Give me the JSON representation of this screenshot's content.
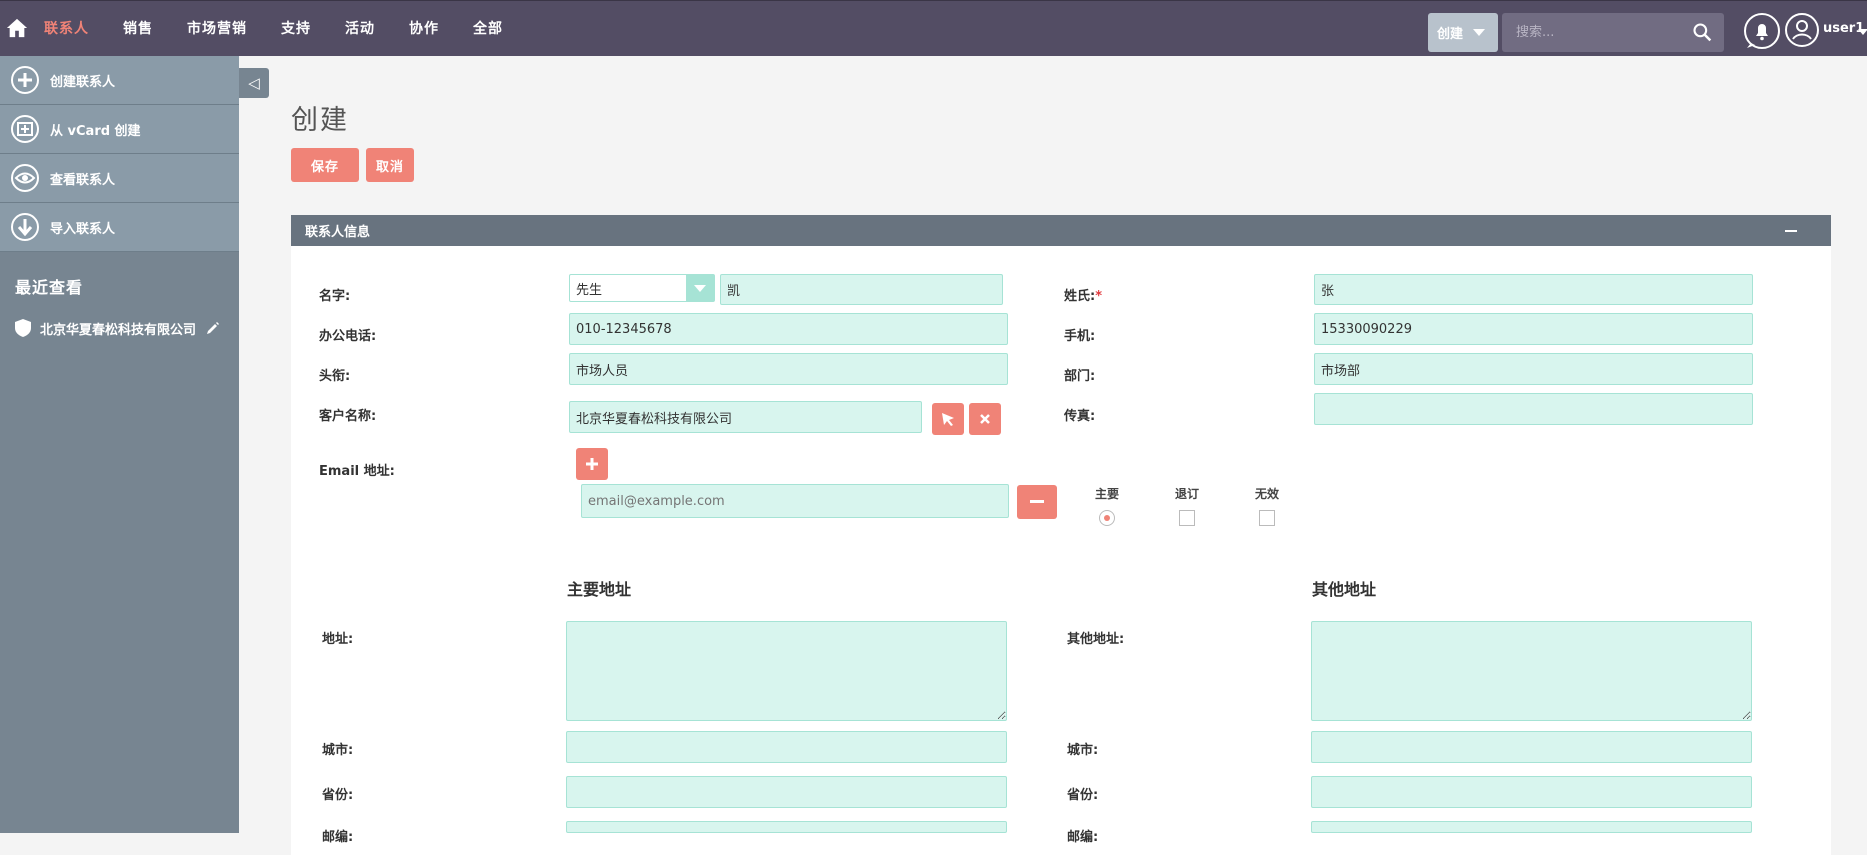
{
  "nav": {
    "items": [
      "联系人",
      "销售",
      "市场营销",
      "支持",
      "活动",
      "协作",
      "全部"
    ],
    "active_index": 0,
    "create_label": "创建",
    "search_placeholder": "搜索...",
    "username": "user1"
  },
  "sidebar": {
    "actions": [
      {
        "label": "创建联系人",
        "icon": "plus-circle-icon"
      },
      {
        "label": "从 vCard 创建",
        "icon": "vcard-icon"
      },
      {
        "label": "查看联系人",
        "icon": "eye-icon"
      },
      {
        "label": "导入联系人",
        "icon": "download-icon"
      }
    ],
    "recent_title": "最近查看",
    "recent_items": [
      {
        "label": "北京华夏春松科技有限公司"
      }
    ]
  },
  "page": {
    "title": "创建",
    "save_label": "保存",
    "cancel_label": "取消"
  },
  "panel": {
    "title": "联系人信息",
    "fields": {
      "first_name_label": "名字:",
      "salutation": "先生",
      "first_name": "凯",
      "last_name_label": "姓氏:",
      "last_name_required": "*",
      "last_name": "张",
      "office_phone_label": "办公电话:",
      "office_phone": "010-12345678",
      "mobile_label": "手机:",
      "mobile": "15330090229",
      "title_label": "头衔:",
      "title": "市场人员",
      "department_label": "部门:",
      "department": "市场部",
      "account_label": "客户名称:",
      "account": "北京华夏春松科技有限公司",
      "fax_label": "传真:",
      "fax": "",
      "email_label": "Email 地址:",
      "email_placeholder": "email@example.com",
      "email_primary_label": "主要",
      "email_optout_label": "退订",
      "email_invalid_label": "无效"
    },
    "address": {
      "primary_title": "主要地址",
      "other_title": "其他地址",
      "address_label": "地址:",
      "other_address_label": "其他地址:",
      "city_label": "城市:",
      "state_label": "省份:",
      "postal_label": "邮编:"
    }
  },
  "colors": {
    "topbar": "#534d64",
    "accent": "#f08377",
    "sidebar": "#778591",
    "field_bg": "#d8f5ee"
  }
}
